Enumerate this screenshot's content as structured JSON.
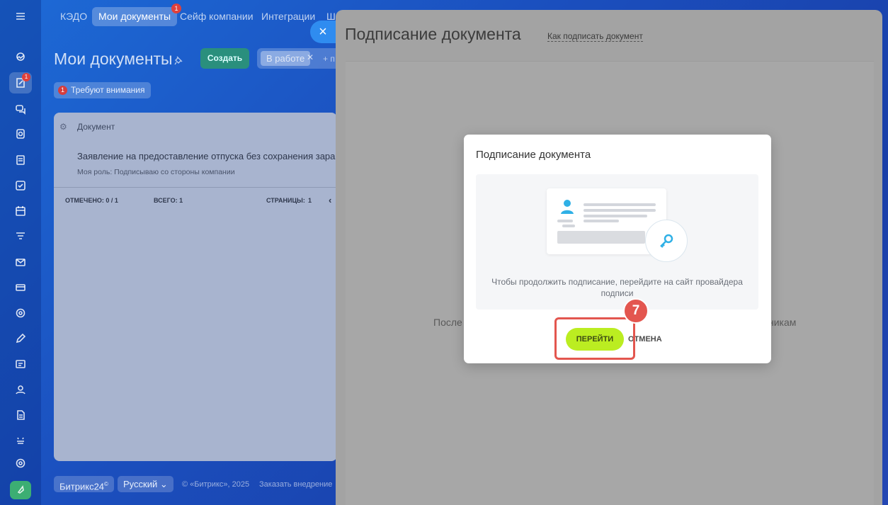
{
  "top_tabs": [
    {
      "label": "КЭДО"
    },
    {
      "label": "Мои документы",
      "badge": "1"
    },
    {
      "label": "Сейф компании"
    },
    {
      "label": "Интеграции"
    },
    {
      "label": "Ш"
    }
  ],
  "sidebar": {
    "badge": "1"
  },
  "page": {
    "title": "Мои документы",
    "create_label": "Создать",
    "filter_chip": "В работе",
    "filter_add": "+ п",
    "attention_count": "1",
    "attention_label": "Требуют внимания"
  },
  "grid": {
    "column_header": "Документ",
    "row_title": "Заявление на предоставление отпуска без сохранения зараб.",
    "row_role": "Моя роль: Подписываю со стороны компании",
    "marked": "ОТМЕЧЕНО: 0 / 1",
    "total": "ВСЕГО: 1",
    "pages": "СТРАНИЦЫ:",
    "pages_value": "1"
  },
  "footer": {
    "brand": "Битрикс24",
    "brand_mark": "©",
    "language": "Русский",
    "copyright": "© «Битрикс», 2025",
    "order": "Заказать внедрение"
  },
  "slider": {
    "close": "×",
    "title": "Подписание документа",
    "help_link": "Как подписать документ",
    "bg_text_left": "После",
    "bg_text_right": "никам"
  },
  "modal": {
    "title": "Подписание документа",
    "message": "Чтобы продолжить подписание, перейдите на сайт провайдера подписи",
    "go_label": "ПЕРЕЙТИ",
    "cancel_label": "ОТМЕНА"
  },
  "annotation": {
    "step": "7",
    "color": "#e3564f"
  },
  "colors": {
    "accent_button": "#bbed21",
    "create_button": "#2a8f7d"
  }
}
